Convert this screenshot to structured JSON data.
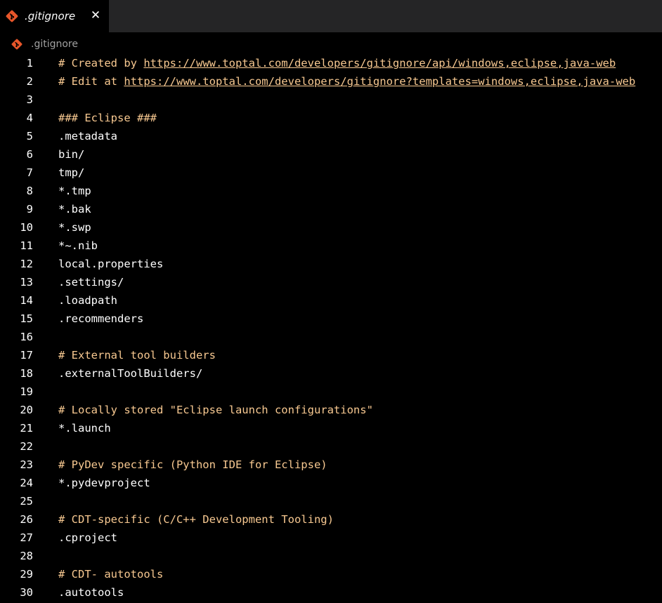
{
  "tab": {
    "title": ".gitignore",
    "close": "✕",
    "icon": "git-icon",
    "icon_color": "#e8562a"
  },
  "breadcrumb": {
    "label": ".gitignore",
    "icon": "git-icon"
  },
  "colors": {
    "background": "#000000",
    "comment": "#f8c991",
    "text": "#ffffff",
    "tabbar": "#252526"
  },
  "lines": [
    {
      "num": "1",
      "type": "comment-link",
      "text": "# Created by ",
      "link": "https://www.toptal.com/developers/gitignore/api/windows,eclipse,java-web"
    },
    {
      "num": "2",
      "type": "comment-link",
      "text": "# Edit at ",
      "link": "https://www.toptal.com/developers/gitignore?templates=windows,eclipse,java-web"
    },
    {
      "num": "3",
      "type": "text",
      "text": ""
    },
    {
      "num": "4",
      "type": "comment",
      "text": "### Eclipse ###"
    },
    {
      "num": "5",
      "type": "text",
      "text": ".metadata"
    },
    {
      "num": "6",
      "type": "text",
      "text": "bin/"
    },
    {
      "num": "7",
      "type": "text",
      "text": "tmp/"
    },
    {
      "num": "8",
      "type": "text",
      "text": "*.tmp"
    },
    {
      "num": "9",
      "type": "text",
      "text": "*.bak"
    },
    {
      "num": "10",
      "type": "text",
      "text": "*.swp"
    },
    {
      "num": "11",
      "type": "text",
      "text": "*~.nib"
    },
    {
      "num": "12",
      "type": "text",
      "text": "local.properties"
    },
    {
      "num": "13",
      "type": "text",
      "text": ".settings/"
    },
    {
      "num": "14",
      "type": "text",
      "text": ".loadpath"
    },
    {
      "num": "15",
      "type": "text",
      "text": ".recommenders"
    },
    {
      "num": "16",
      "type": "text",
      "text": ""
    },
    {
      "num": "17",
      "type": "comment",
      "text": "# External tool builders"
    },
    {
      "num": "18",
      "type": "text",
      "text": ".externalToolBuilders/"
    },
    {
      "num": "19",
      "type": "text",
      "text": ""
    },
    {
      "num": "20",
      "type": "comment",
      "text": "# Locally stored \"Eclipse launch configurations\""
    },
    {
      "num": "21",
      "type": "text",
      "text": "*.launch"
    },
    {
      "num": "22",
      "type": "text",
      "text": ""
    },
    {
      "num": "23",
      "type": "comment",
      "text": "# PyDev specific (Python IDE for Eclipse)"
    },
    {
      "num": "24",
      "type": "text",
      "text": "*.pydevproject"
    },
    {
      "num": "25",
      "type": "text",
      "text": ""
    },
    {
      "num": "26",
      "type": "comment",
      "text": "# CDT-specific (C/C++ Development Tooling)"
    },
    {
      "num": "27",
      "type": "text",
      "text": ".cproject"
    },
    {
      "num": "28",
      "type": "text",
      "text": ""
    },
    {
      "num": "29",
      "type": "comment",
      "text": "# CDT- autotools"
    },
    {
      "num": "30",
      "type": "text",
      "text": ".autotools"
    }
  ]
}
